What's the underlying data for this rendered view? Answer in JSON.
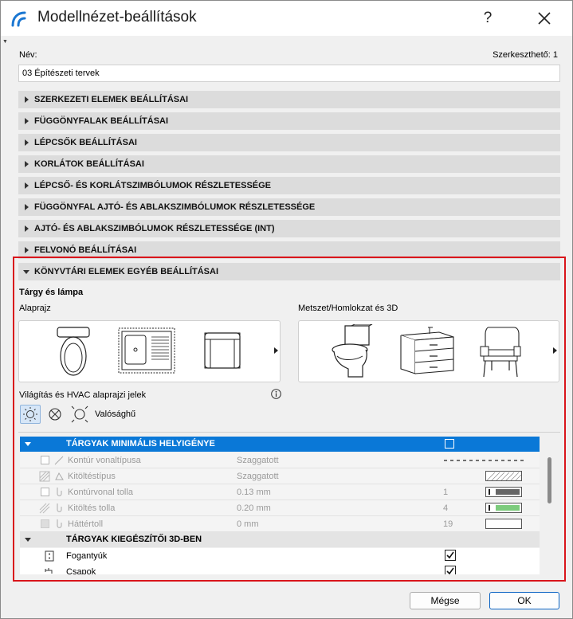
{
  "window": {
    "title": "Modellnézet-beállítások",
    "help": "?"
  },
  "name_field": {
    "label": "Név:",
    "value": "03 Építészeti tervek",
    "editable": "Szerkeszthető: 1"
  },
  "sections": [
    "SZERKEZETI ELEMEK BEÁLLÍTÁSAI",
    "FÜGGÖNYFALAK BEÁLLÍTÁSAI",
    "LÉPCSŐK BEÁLLÍTÁSAI",
    "KORLÁTOK BEÁLLÍTÁSAI",
    "LÉPCSŐ- ÉS KORLÁTSZIMBÓLUMOK RÉSZLETESSÉGE",
    "FÜGGÖNYFAL AJTÓ- ÉS ABLAKSZIMBÓLUMOK RÉSZLETESSÉGE",
    "AJTÓ- ÉS ABLAKSZIMBÓLUMOK RÉSZLETESSÉGE (INT)",
    "FELVONÓ BEÁLLÍTÁSAI"
  ],
  "library": {
    "section": "KÖNYVTÁRI ELEMEK EGYÉB BEÁLLÍTÁSAI",
    "subtitle": "Tárgy és lámpa",
    "floorplan_label": "Alaprajz",
    "section3d_label": "Metszet/Homlokzat és 3D",
    "hvac_label": "Világítás és HVAC alaprajzi jelek",
    "realistic_label": "Valósághű"
  },
  "list": {
    "header": "TÁRGYAK MINIMÁLIS HELYIGÉNYE",
    "rows": [
      {
        "name": "Kontúr vonaltípusa",
        "value": "Szaggatott",
        "num": ""
      },
      {
        "name": "Kitöltéstípus",
        "value": "Szaggatott",
        "num": ""
      },
      {
        "name": "Kontúrvonal tolla",
        "value": "0.13 mm",
        "num": "1"
      },
      {
        "name": "Kitöltés tolla",
        "value": "0.20 mm",
        "num": "4"
      },
      {
        "name": "Háttértoll",
        "value": "0 mm",
        "num": "19"
      }
    ],
    "group": "TÁRGYAK KIEGÉSZÍTŐI 3D-BEN",
    "checks": [
      {
        "name": "Fogantyúk"
      },
      {
        "name": "Csapok"
      }
    ]
  },
  "buttons": {
    "cancel": "Mégse",
    "ok": "OK"
  },
  "colors": {
    "accent": "#0a78d7",
    "highlight": "#d9151b",
    "pen_green": "#7ccb7c",
    "pen_dark": "#666666"
  }
}
